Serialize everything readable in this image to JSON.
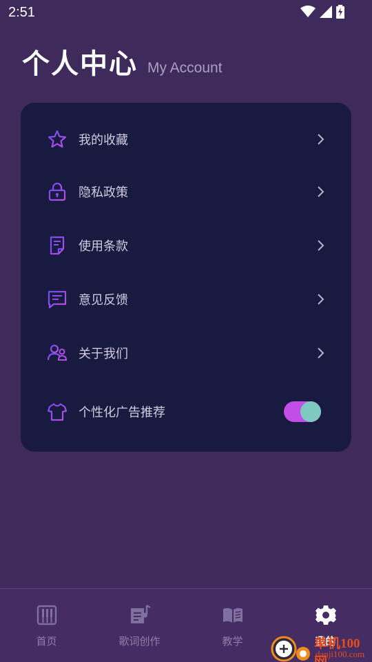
{
  "status_bar": {
    "time": "2:51"
  },
  "header": {
    "title": "个人中心",
    "subtitle": "My Account"
  },
  "menu": {
    "items": [
      {
        "label": "我的收藏",
        "icon": "star-icon"
      },
      {
        "label": "隐私政策",
        "icon": "lock-icon"
      },
      {
        "label": "使用条款",
        "icon": "document-icon"
      },
      {
        "label": "意见反馈",
        "icon": "feedback-chat-icon"
      },
      {
        "label": "关于我们",
        "icon": "users-icon"
      }
    ],
    "toggle_item": {
      "label": "个性化广告推荐",
      "icon": "tshirt-icon",
      "enabled": true
    }
  },
  "bottom_nav": {
    "items": [
      {
        "label": "首页",
        "icon": "piano-icon",
        "active": false
      },
      {
        "label": "歌词创作",
        "icon": "lyrics-music-icon",
        "active": false
      },
      {
        "label": "教学",
        "icon": "book-icon",
        "active": false
      },
      {
        "label": "我的",
        "icon": "gear-icon",
        "active": true
      }
    ]
  },
  "watermark": {
    "text": "单机100网",
    "subtext": "danji100.com"
  },
  "colors": {
    "background": "#3e2b5c",
    "card": "#181a3f",
    "icon_gradient_start": "#6c4cf0",
    "icon_gradient_end": "#c04ee6",
    "toggle_track": "#c24ee8",
    "toggle_knob": "#7ecac0"
  }
}
